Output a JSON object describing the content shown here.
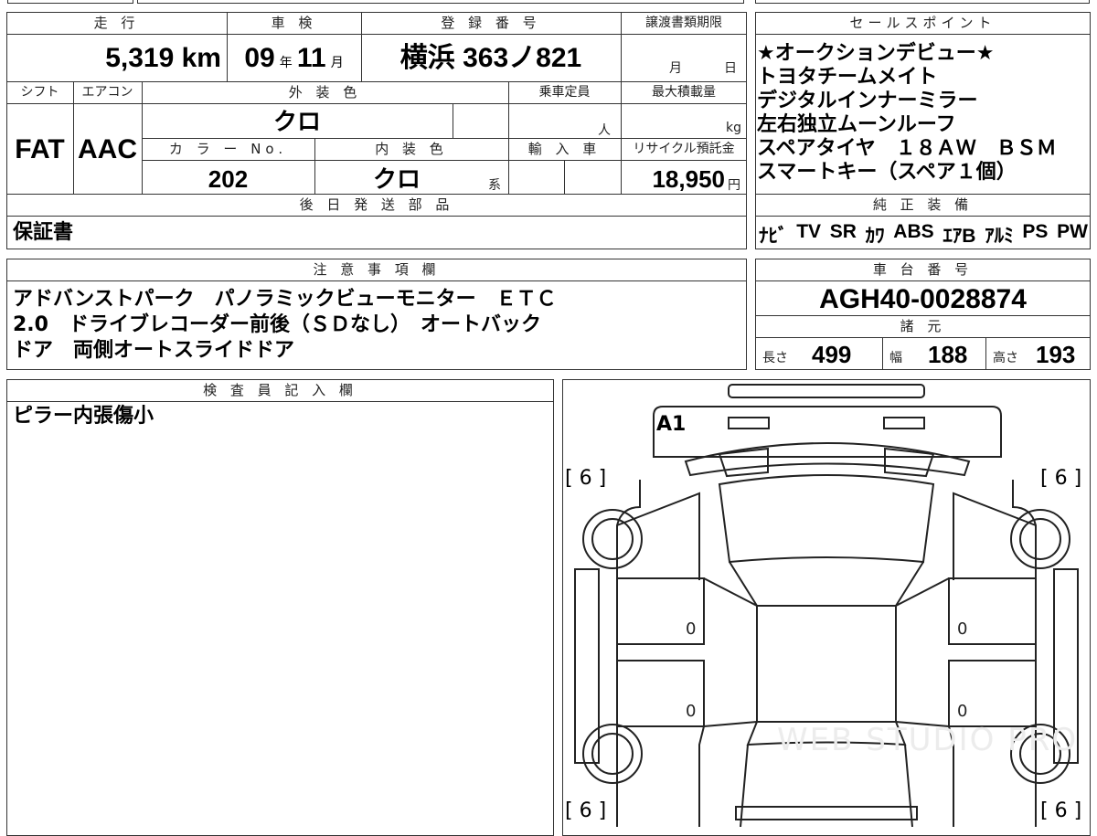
{
  "headers": {
    "mileage": "走 行",
    "shaken": "車 検",
    "registration": "登 録 番 号",
    "transfer_deadline": "譲渡書類期限",
    "sales_points": "セールスポイント",
    "shift": "シフト",
    "aircon": "エアコン",
    "exterior_color": "外 装 色",
    "capacity": "乗車定員",
    "max_load": "最大積載量",
    "color_no": "カ ラ ー No.",
    "interior_color": "内 装 色",
    "import": "輸 入 車",
    "recycle_fee": "リサイクル預託金",
    "later_parts": "後 日 発 送 部 品",
    "genuine_equipment": "純 正 装 備",
    "notes": "注 意 事 項 欄",
    "chassis_number": "車 台 番 号",
    "specs": "諸 元",
    "inspector_notes": "検 査 員 記 入 欄"
  },
  "values": {
    "mileage": "5,319 km",
    "shaken_year": "09",
    "shaken_year_unit": "年",
    "shaken_month": "11",
    "shaken_month_unit": "月",
    "registration": "横浜 363ノ821",
    "deadline_month_unit": "月",
    "deadline_day_unit": "日",
    "shift": "FAT",
    "aircon": "AAC",
    "exterior_color": "クロ",
    "capacity_unit": "人",
    "max_load_unit": "kg",
    "color_no": "202",
    "interior_color": "クロ",
    "interior_suffix": "系",
    "recycle_fee": "18,950",
    "recycle_unit": "円",
    "later_parts": "保証書",
    "chassis_number": "AGH40-0028874",
    "length_label": "長さ",
    "length": "499",
    "width_label": "幅",
    "width": "188",
    "height_label": "高さ",
    "height": "193"
  },
  "sales_points": [
    "★オークションデビュー★",
    "トヨタチームメイト",
    "デジタルインナーミラー",
    "左右独立ムーンルーフ",
    "スペアタイヤ　１８ＡＷ　ＢＳＭ",
    "スマートキー（スペア１個）"
  ],
  "equipment": [
    "ﾅﾋﾞ",
    "TV",
    "SR",
    "ｶﾜ",
    "ABS",
    "ｴｱB",
    "ｱﾙﾐ",
    "PS",
    "PW"
  ],
  "notes_lines": [
    "アドバンストパーク　パノラミックビューモニター　ＥＴＣ",
    "2.0　ドライブレコーダー前後（ＳＤなし）　オートバック",
    "ドア　両側オートスライドドア"
  ],
  "inspector_note": "ピラー内張傷小",
  "diagram": {
    "damage_code": "A1",
    "front_left": "[ 6 ]",
    "front_right": "[ 6 ]",
    "rear_left": "[ 6 ]",
    "rear_right": "[ 6 ]",
    "door_marks": [
      "0",
      "0",
      "0",
      "0"
    ],
    "watermark": "WEB STUDIO PRO"
  }
}
